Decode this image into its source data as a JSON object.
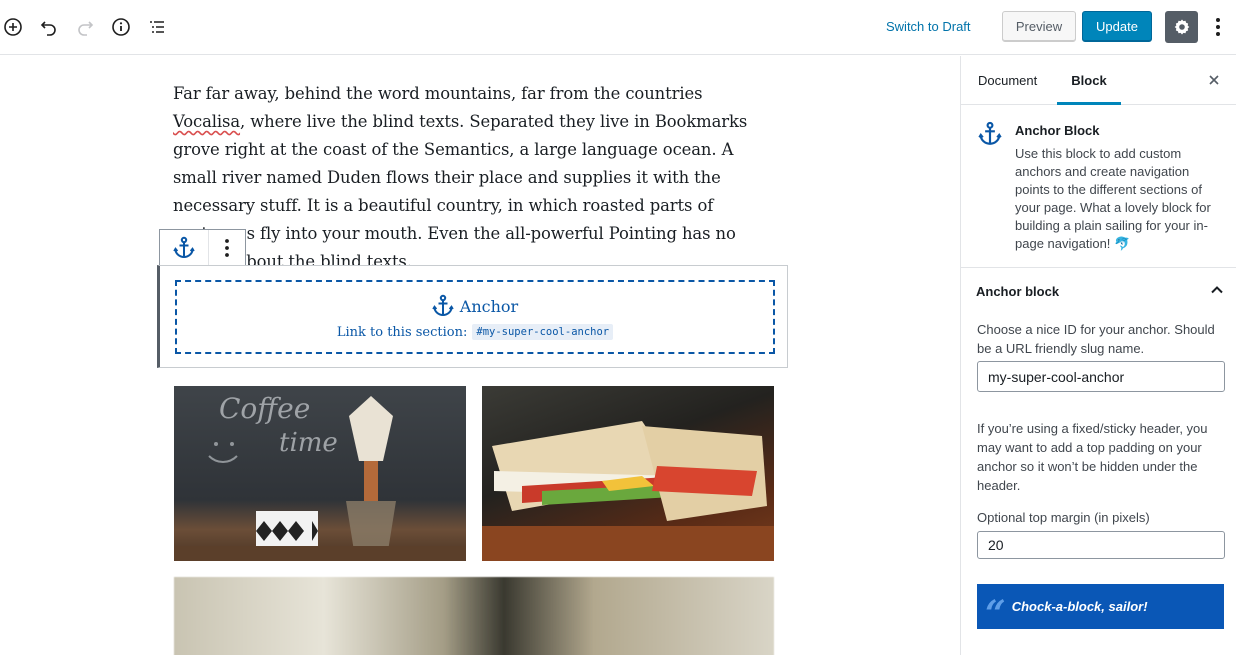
{
  "toolbar": {
    "switch_draft_label": "Switch to Draft",
    "preview_label": "Preview",
    "update_label": "Update",
    "icons": [
      "add-block-icon",
      "undo-icon",
      "redo-icon",
      "info-icon",
      "outline-icon",
      "gear-icon",
      "more-vertical-icon"
    ]
  },
  "editor": {
    "paragraph_before": "Far far away, behind the word mountains, far from the countries ",
    "paragraph_spell": "Vocalisa",
    "paragraph_after": ", where live the blind texts. Separated they live in Bookmarks grove right at the coast of the Semantics, a large language ocean. A small river named Duden flows their place and supplies it with the necessary stuff. It is a beautiful country, in which roasted parts of sentences fly into your mouth. Even the all-powerful Pointing has no control about the blind texts.",
    "anchor_block": {
      "title": "Anchor",
      "link_label": "Link to this section:",
      "code": "#my-super-cool-anchor"
    }
  },
  "sidebar": {
    "tabs": {
      "document": "Document",
      "block": "Block"
    },
    "card": {
      "title": "Anchor Block",
      "description": "Use this block to add custom anchors and create navigation points to the different sections of your page. What a lovely block for building a plain sailing for your in-page navigation! 🐬"
    },
    "panel": {
      "title": "Anchor block",
      "id_help": "Choose a nice ID for your anchor. Should be a URL friendly slug name.",
      "id_value": "my-super-cool-anchor",
      "header_help": "If you’re using a fixed/sticky header, you may want to add a top padding on your anchor so it won’t be hidden under the header.",
      "margin_label": "Optional top margin (in pixels)",
      "margin_value": "20",
      "quote": "Chock-a-block, sailor!"
    }
  },
  "colors": {
    "accent": "#0085ba",
    "anchor_blue": "#0a57a6",
    "quote_bg": "#0a57b6"
  }
}
